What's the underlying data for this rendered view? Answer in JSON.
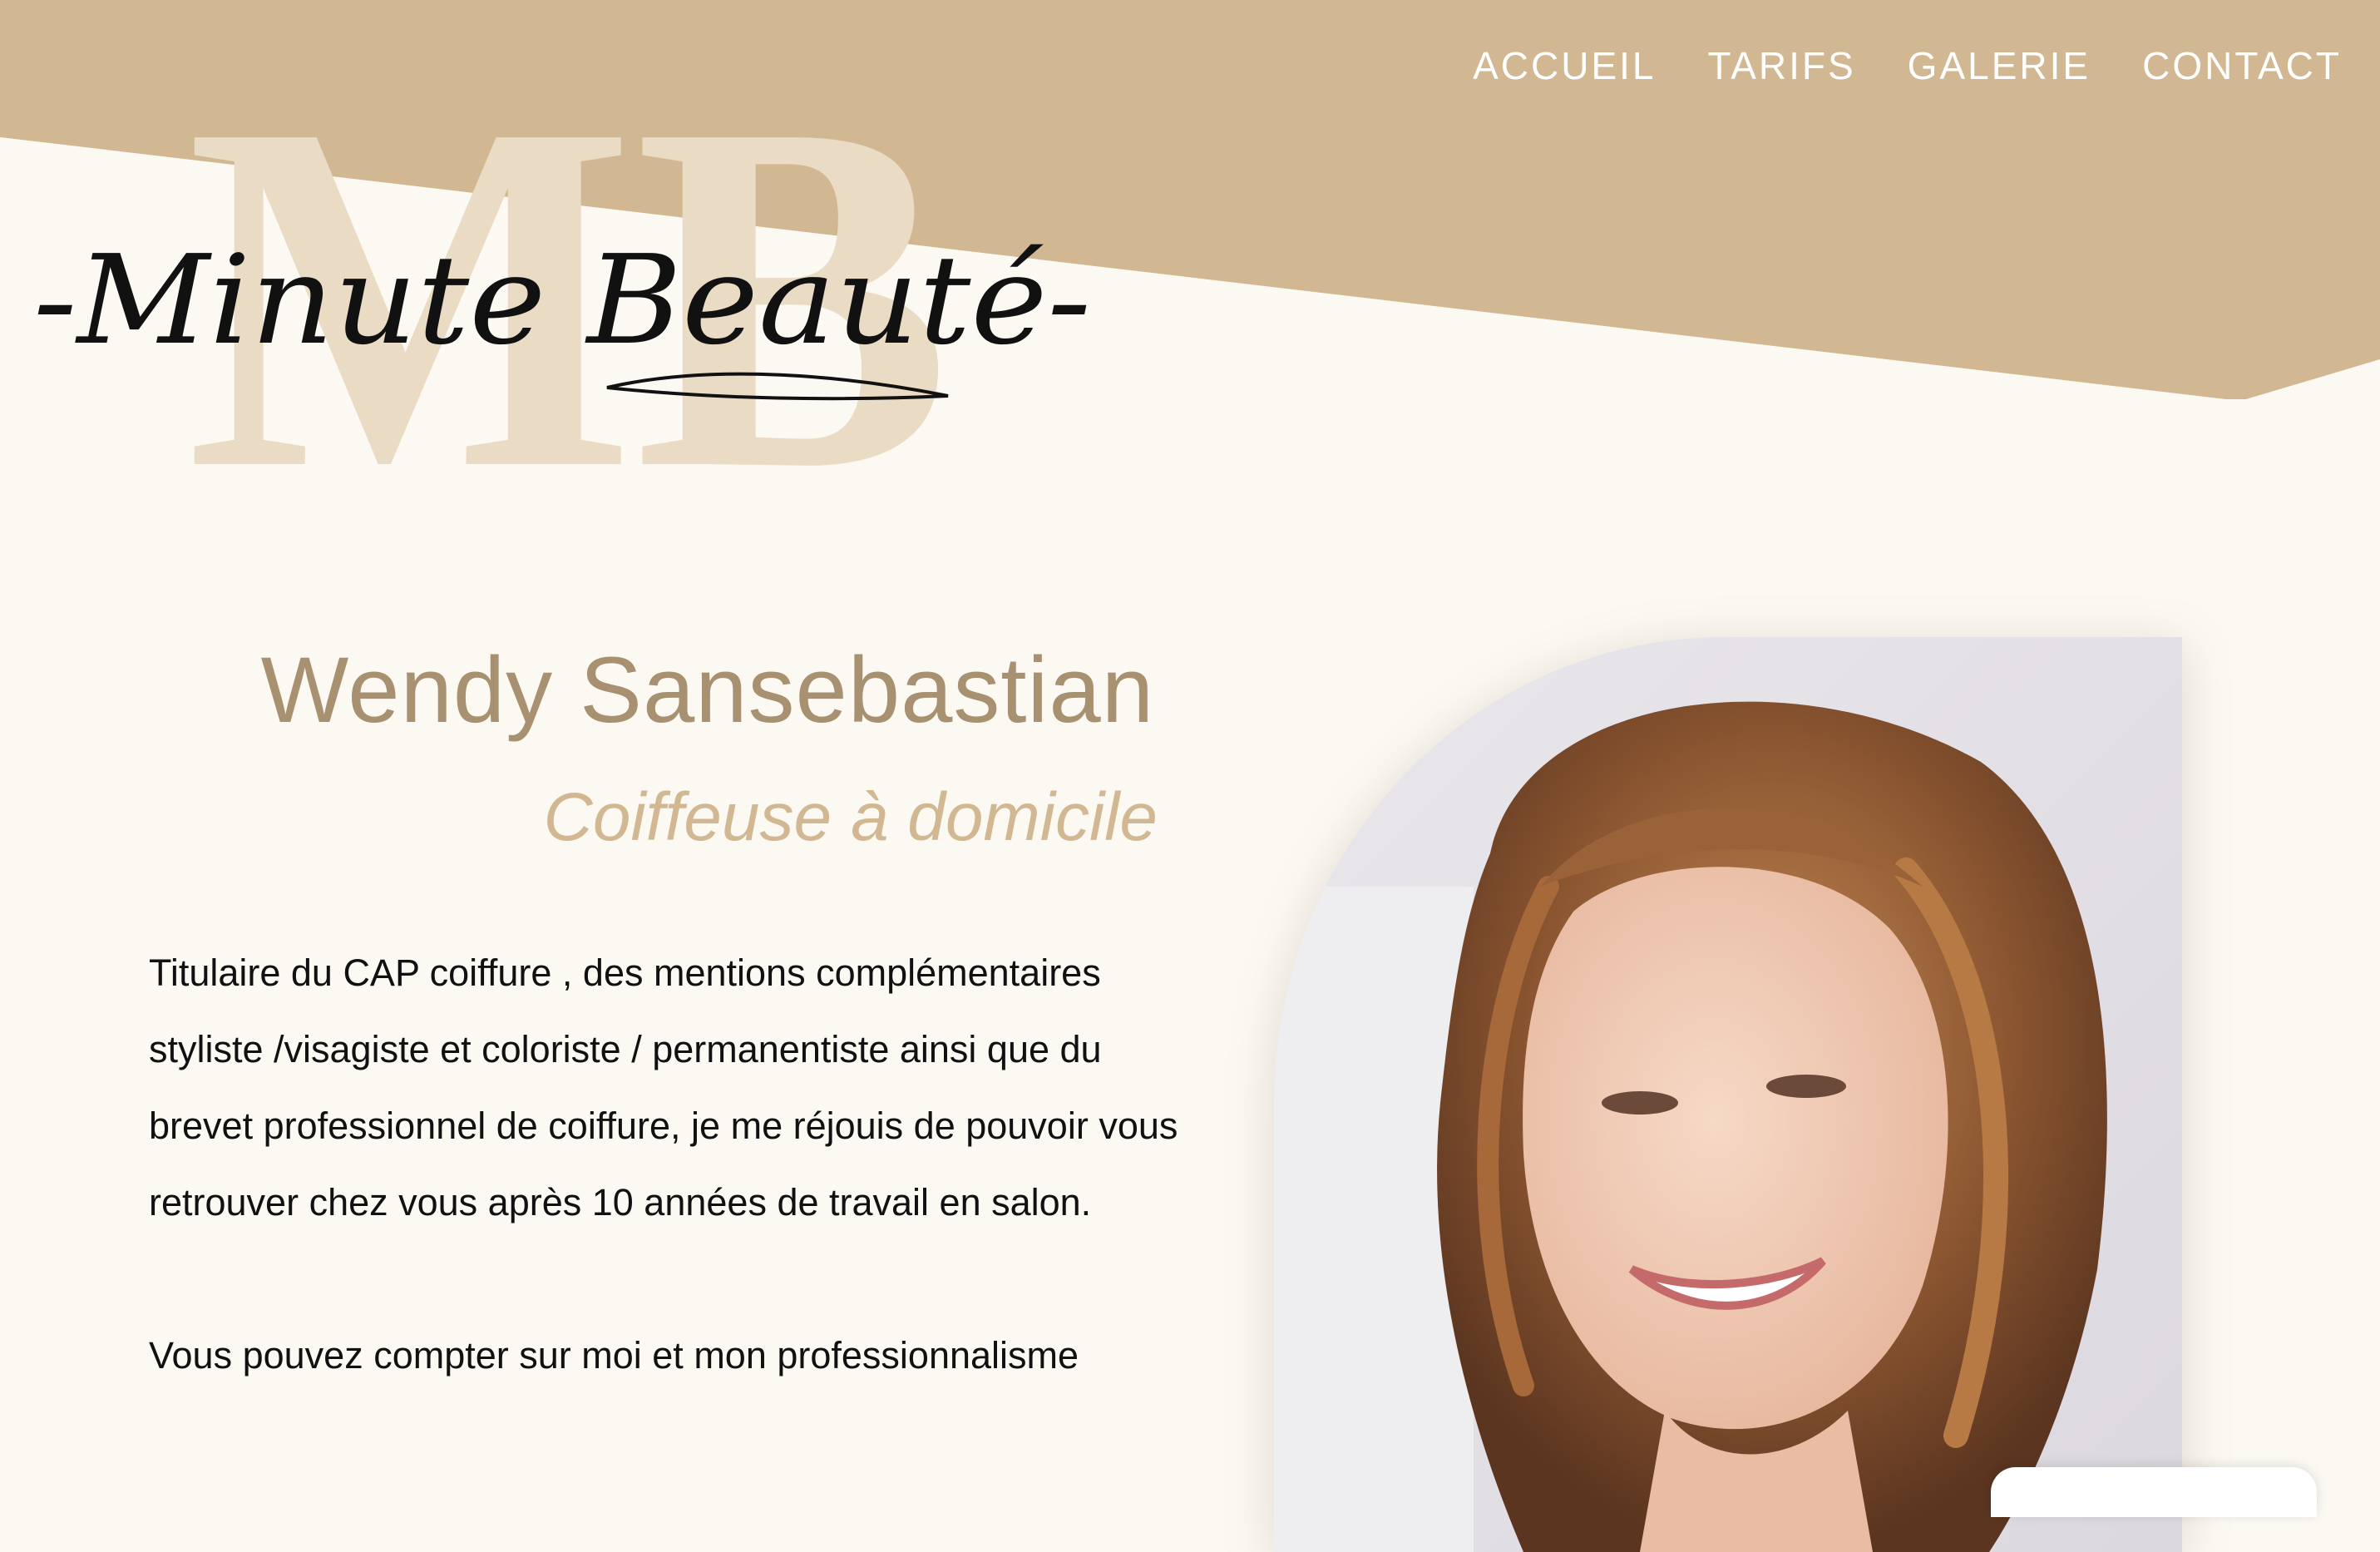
{
  "colors": {
    "background": "#FCF9F3",
    "header_band": "#D1B892",
    "logo_monogram": "#EADBC4",
    "logo_script": "#111111",
    "name_text": "#A89171",
    "role_text": "#D1B892",
    "nav_text": "#FFFFFF",
    "body_text": "#111111"
  },
  "brand": {
    "monogram": "MB",
    "script": "-Minute Beauté-"
  },
  "nav": {
    "items": [
      {
        "label": "ACCUEIL"
      },
      {
        "label": "TARIFS"
      },
      {
        "label": "GALERIE"
      },
      {
        "label": "CONTACT"
      }
    ]
  },
  "profile": {
    "name": "Wendy Sansebastian",
    "role": "Coiffeuse à domicile",
    "bio": [
      "Titulaire du CAP coiffure , des mentions complémentaires stylistе /visagiste et coloriste / permanentiste ainsi que du brevet professionnel de coiffure, je me réjouis de pouvoir vous retrouver chez vous après 10 années de travail en salon.",
      "Vous pouvez compter sur moi et mon professionnalisme"
    ],
    "photo_icon": "portrait-photo"
  }
}
